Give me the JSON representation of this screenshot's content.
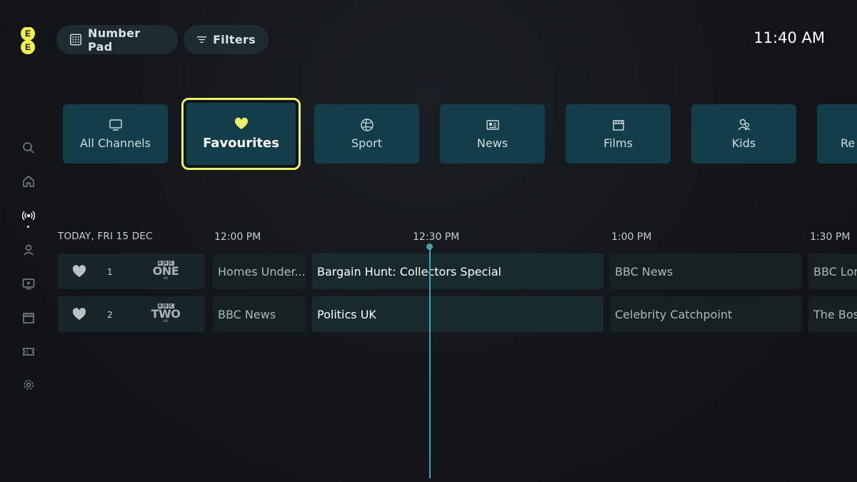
{
  "brand": {
    "logo_letters": [
      "E",
      "E"
    ],
    "logo_color": "#f0f04f"
  },
  "header": {
    "number_pad_label": "Number Pad",
    "filters_label": "Filters",
    "clock": "11:40 AM"
  },
  "side_nav": {
    "items": [
      "search-icon",
      "home-icon",
      "live-tv-icon",
      "profile-icon",
      "play-icon",
      "films-icon",
      "tickets-icon",
      "settings-icon"
    ],
    "active": "live-tv-icon"
  },
  "categories": [
    {
      "label": "All Channels",
      "icon": "tv-icon"
    },
    {
      "label": "Favourites",
      "icon": "heart-icon",
      "focused": true
    },
    {
      "label": "Sport",
      "icon": "ball-icon"
    },
    {
      "label": "News",
      "icon": "newspaper-icon"
    },
    {
      "label": "Films",
      "icon": "clapperboard-icon"
    },
    {
      "label": "Kids",
      "icon": "kids-icon"
    },
    {
      "label": "Re",
      "icon": ""
    }
  ],
  "guide": {
    "date": "TODAY, FRI 15 DEC",
    "times": [
      "12:00 PM",
      "12:30 PM",
      "1:00 PM",
      "1:30 PM"
    ],
    "channels": [
      {
        "number": "1",
        "logo_boxes": [
          "B",
          "B",
          "C"
        ],
        "logo_name": "ONE",
        "logo_sub": "HD",
        "programmes": [
          "Homes Under...",
          "Bargain Hunt: Collectors Special",
          "BBC News",
          "BBC Lor"
        ]
      },
      {
        "number": "2",
        "logo_boxes": [
          "B",
          "B",
          "C"
        ],
        "logo_name": "TWO",
        "logo_sub": "HD",
        "programmes": [
          "BBC News",
          "Politics UK",
          "Celebrity Catchpoint",
          "The Bos"
        ]
      }
    ]
  },
  "colors": {
    "accent_focus": "#ecef6c",
    "tile_bg": "#133e49",
    "now_line": "#4aa0ae"
  }
}
